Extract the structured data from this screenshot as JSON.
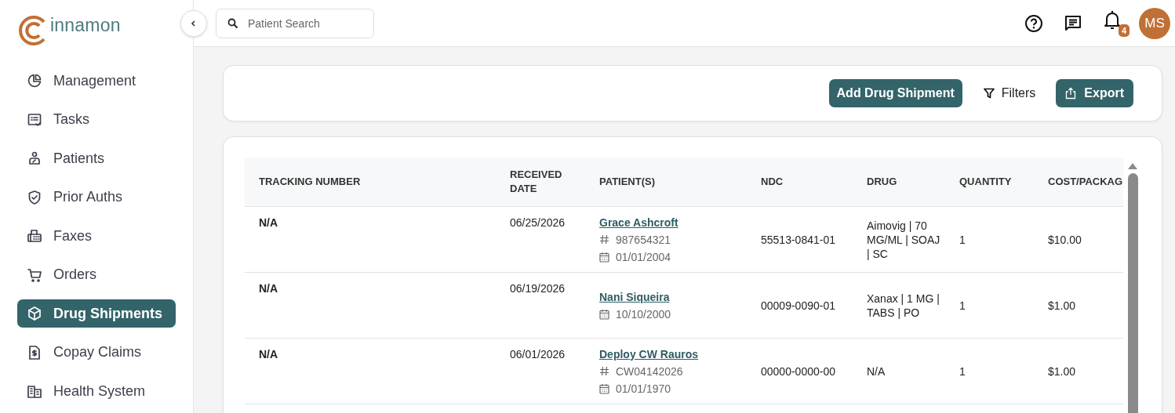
{
  "logo": {
    "text": "innamon"
  },
  "search": {
    "placeholder": "Patient Search"
  },
  "header": {
    "notification_count": "4",
    "avatar_initials": "MS"
  },
  "sidebar": {
    "items": [
      {
        "label": "Management",
        "selected": false
      },
      {
        "label": "Tasks",
        "selected": false
      },
      {
        "label": "Patients",
        "selected": false
      },
      {
        "label": "Prior Auths",
        "selected": false
      },
      {
        "label": "Faxes",
        "selected": false
      },
      {
        "label": "Orders",
        "selected": false
      },
      {
        "label": "Drug Shipments",
        "selected": true
      },
      {
        "label": "Copay Claims",
        "selected": false
      },
      {
        "label": "Health System",
        "selected": false
      }
    ]
  },
  "toolbar": {
    "add_button": "Add Drug Shipment",
    "filters_button": "Filters",
    "export_button": "Export"
  },
  "table": {
    "columns": [
      "TRACKING NUMBER",
      "RECEIVED DATE",
      "PATIENT(S)",
      "NDC",
      "DRUG",
      "QUANTITY",
      "COST/PACKAG"
    ],
    "rows": [
      {
        "tracking_number": "N/A",
        "received_date": "06/25/2026",
        "patient": {
          "name": "Grace Ashcroft",
          "id": "987654321",
          "dob": "01/01/2004"
        },
        "ndc": "55513-0841-01",
        "drug": "Aimovig | 70 MG/ML | SOAJ | SC",
        "quantity": "1",
        "cost": "$10.00"
      },
      {
        "tracking_number": "N/A",
        "received_date": "06/19/2026",
        "patient": {
          "name": "Nani Siqueira",
          "dob": "10/10/2000"
        },
        "ndc": "00009-0090-01",
        "drug": "Xanax | 1 MG | TABS | PO",
        "quantity": "1",
        "cost": "$1.00"
      },
      {
        "tracking_number": "N/A",
        "received_date": "06/01/2026",
        "patient": {
          "name": "Deploy CW Rauros",
          "id": "CW04142026",
          "dob": "01/01/1970"
        },
        "ndc": "00000-0000-00",
        "drug": "N/A",
        "quantity": "1",
        "cost": "$1.00"
      }
    ]
  }
}
